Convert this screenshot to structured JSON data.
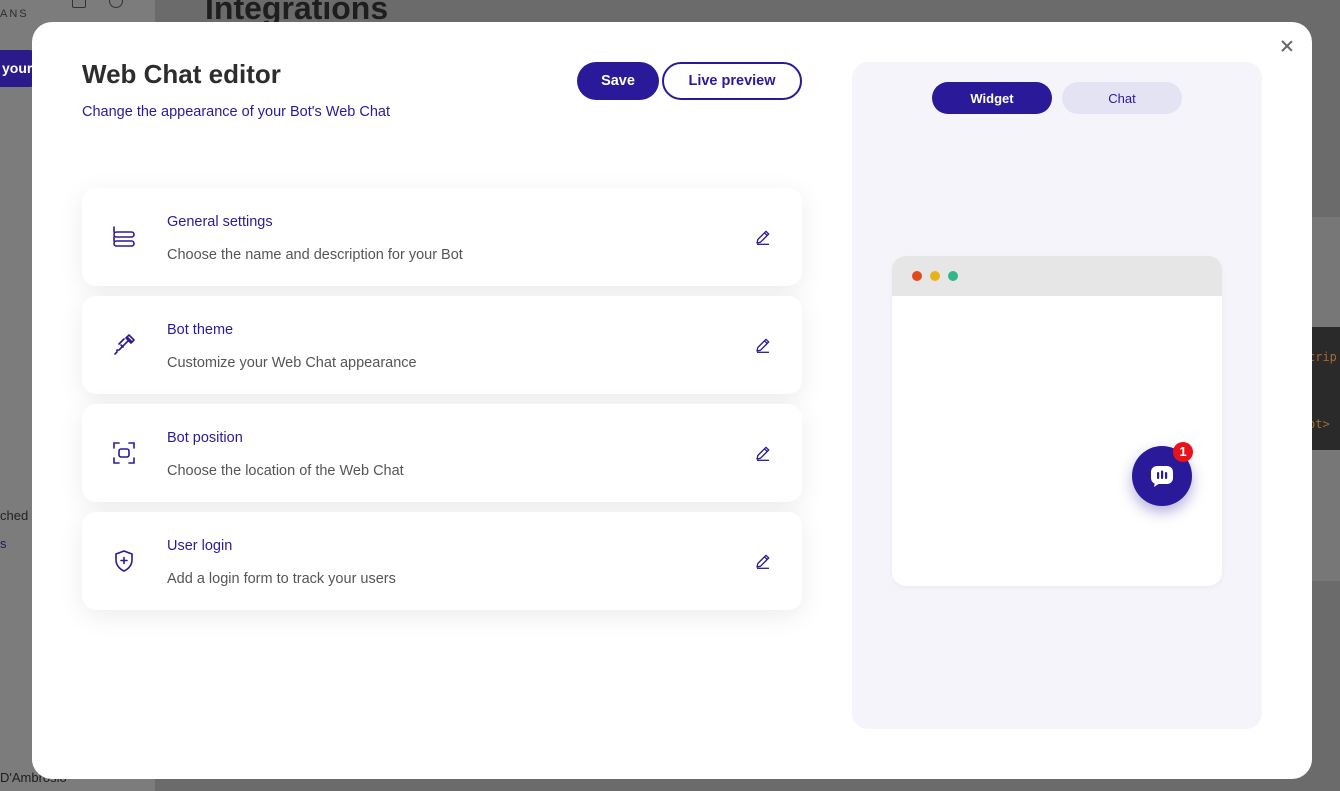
{
  "background": {
    "page_title": "Integrations",
    "logo_text": "ANS",
    "sidebar_pill_text": "your",
    "sidebar_text_1": "ched",
    "sidebar_text_2": "s",
    "sidebar_text_3": "D'Ambrosio",
    "code_text_1": "crip",
    "code_text_2": "ot>"
  },
  "editor": {
    "title": "Web Chat editor",
    "subtitle": "Change the appearance of your Bot's Web Chat",
    "save_label": "Save",
    "live_preview_label": "Live preview"
  },
  "settings_cards": [
    {
      "title": "General settings",
      "description": "Choose the name and description for your Bot",
      "icon": "stack-icon"
    },
    {
      "title": "Bot theme",
      "description": "Customize your Web Chat appearance",
      "icon": "eyedropper-icon"
    },
    {
      "title": "Bot position",
      "description": "Choose the location of the Web Chat",
      "icon": "focus-frame-icon"
    },
    {
      "title": "User login",
      "description": "Add a login form to track your users",
      "icon": "shield-plus-icon"
    }
  ],
  "preview": {
    "tabs": [
      {
        "label": "Widget",
        "active": true
      },
      {
        "label": "Chat",
        "active": false
      }
    ],
    "browser_dots": [
      "#e14a1d",
      "#e8b31a",
      "#33b58a"
    ],
    "launcher_badge": "1"
  },
  "colors": {
    "accent": "#2a1a9a",
    "badge": "#e8121a",
    "panel_bg": "#f4f4fa"
  }
}
